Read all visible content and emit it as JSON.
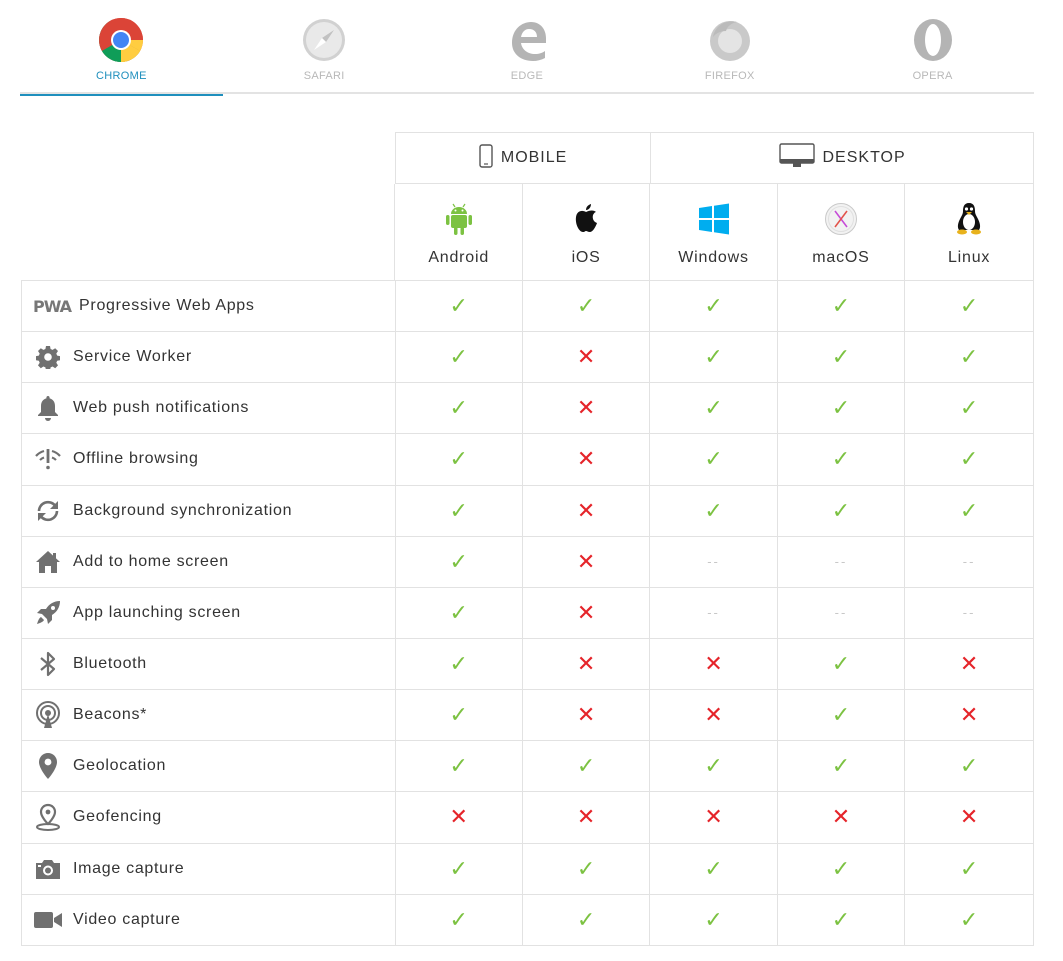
{
  "browser_tabs": [
    {
      "label": "CHROME",
      "icon": "chrome-icon",
      "active": true
    },
    {
      "label": "SAFARI",
      "icon": "safari-icon",
      "active": false
    },
    {
      "label": "EDGE",
      "icon": "edge-icon",
      "active": false
    },
    {
      "label": "FIREFOX",
      "icon": "firefox-icon",
      "active": false
    },
    {
      "label": "OPERA",
      "icon": "opera-icon",
      "active": false
    }
  ],
  "groups": {
    "mobile": {
      "label": "MOBILE",
      "icon": "phone-icon"
    },
    "desktop": {
      "label": "DESKTOP",
      "icon": "monitor-icon"
    }
  },
  "platforms": [
    {
      "name": "Android",
      "icon": "android-icon"
    },
    {
      "name": "iOS",
      "icon": "apple-icon"
    },
    {
      "name": "Windows",
      "icon": "windows-icon"
    },
    {
      "name": "macOS",
      "icon": "macos-icon"
    },
    {
      "name": "Linux",
      "icon": "linux-icon"
    }
  ],
  "colors": {
    "yes": "#7cc242",
    "no": "#e5242a",
    "accent": "#1f8fbd",
    "na": "#c8c8c8"
  },
  "marks": {
    "yes": "✓",
    "no": "✕",
    "na": "--"
  },
  "features": [
    {
      "label": "Progressive Web Apps",
      "icon": "pwa-logo",
      "logo_text": "PWA",
      "support": [
        "yes",
        "yes",
        "yes",
        "yes",
        "yes"
      ]
    },
    {
      "label": "Service Worker",
      "icon": "gear-icon",
      "support": [
        "yes",
        "no",
        "yes",
        "yes",
        "yes"
      ]
    },
    {
      "label": "Web push notifications",
      "icon": "bell-icon",
      "support": [
        "yes",
        "no",
        "yes",
        "yes",
        "yes"
      ]
    },
    {
      "label": "Offline browsing",
      "icon": "offline-wifi-icon",
      "support": [
        "yes",
        "no",
        "yes",
        "yes",
        "yes"
      ]
    },
    {
      "label": "Background synchronization",
      "icon": "sync-icon",
      "support": [
        "yes",
        "no",
        "yes",
        "yes",
        "yes"
      ]
    },
    {
      "label": "Add to home screen",
      "icon": "home-icon",
      "support": [
        "yes",
        "no",
        "na",
        "na",
        "na"
      ]
    },
    {
      "label": "App launching screen",
      "icon": "rocket-icon",
      "support": [
        "yes",
        "no",
        "na",
        "na",
        "na"
      ]
    },
    {
      "label": "Bluetooth",
      "icon": "bluetooth-icon",
      "support": [
        "yes",
        "no",
        "no",
        "yes",
        "no"
      ]
    },
    {
      "label": "Beacons*",
      "icon": "beacon-icon",
      "support": [
        "yes",
        "no",
        "no",
        "yes",
        "no"
      ]
    },
    {
      "label": "Geolocation",
      "icon": "location-pin-icon",
      "support": [
        "yes",
        "yes",
        "yes",
        "yes",
        "yes"
      ]
    },
    {
      "label": "Geofencing",
      "icon": "geofence-icon",
      "support": [
        "no",
        "no",
        "no",
        "no",
        "no"
      ]
    },
    {
      "label": "Image capture",
      "icon": "camera-icon",
      "support": [
        "yes",
        "yes",
        "yes",
        "yes",
        "yes"
      ]
    },
    {
      "label": "Video capture",
      "icon": "video-camera-icon",
      "support": [
        "yes",
        "yes",
        "yes",
        "yes",
        "yes"
      ]
    }
  ]
}
